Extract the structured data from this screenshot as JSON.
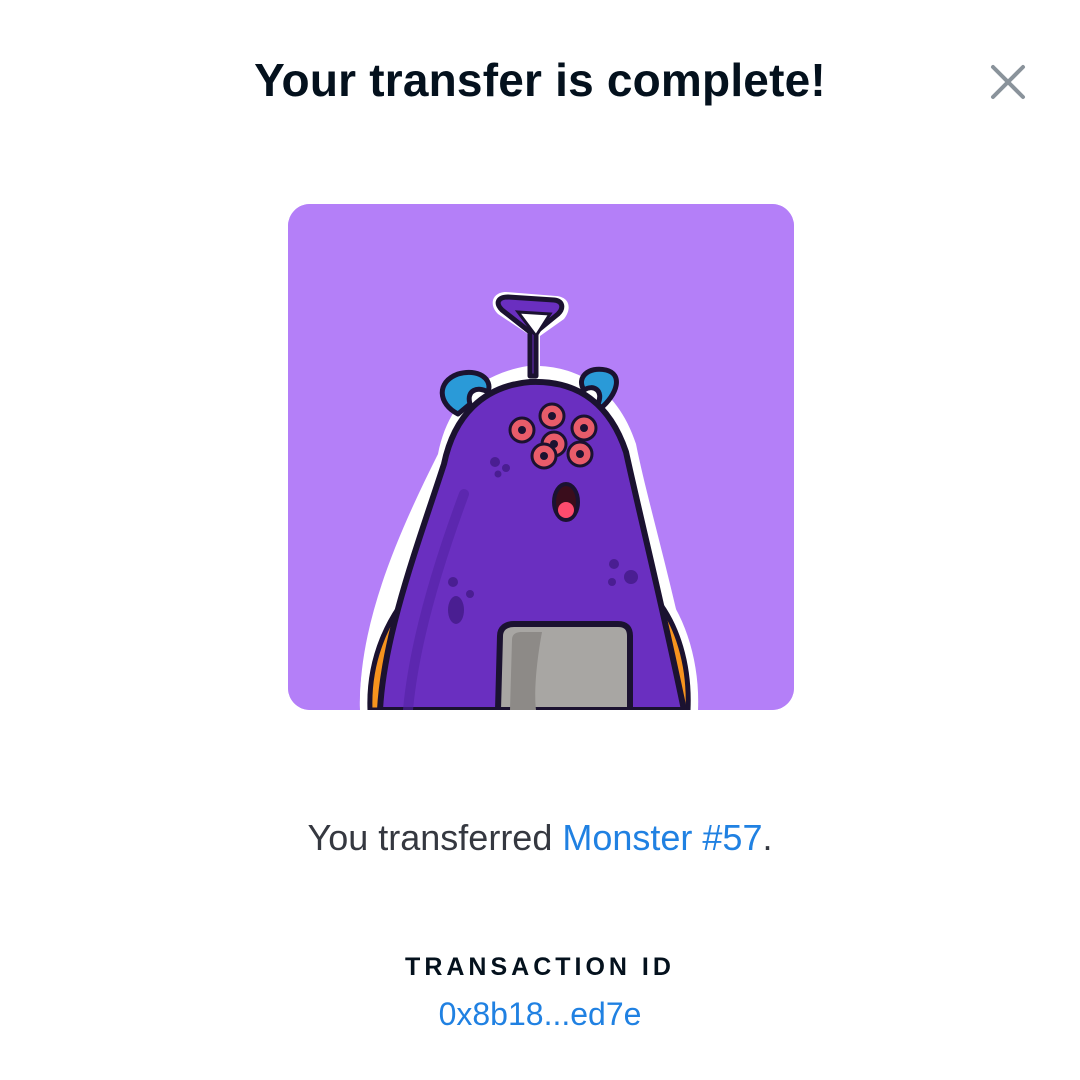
{
  "dialog": {
    "title": "Your transfer is complete!",
    "close_icon": "close-icon"
  },
  "nft": {
    "image_alt": "Monster #57",
    "background_color": "#b47ff8"
  },
  "message": {
    "prefix": "You transferred ",
    "item_name": "Monster #57",
    "suffix": "."
  },
  "transaction": {
    "label": "TRANSACTION ID",
    "id_short": "0x8b18...ed7e"
  },
  "colors": {
    "link": "#2081e2",
    "heading": "#04111d",
    "body_text": "#353840",
    "close_icon": "#8a939b"
  }
}
